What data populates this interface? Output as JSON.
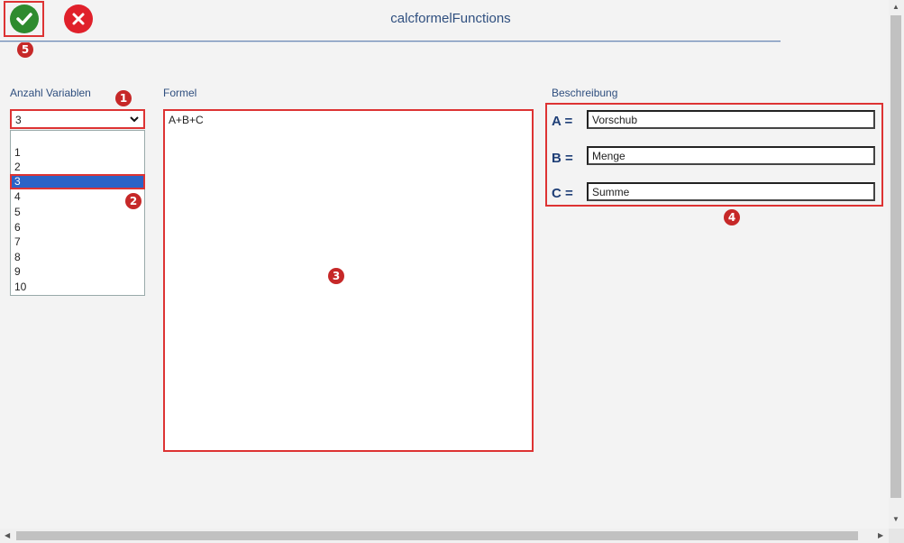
{
  "toolbar": {
    "ok_icon": "checkmark-circle-icon",
    "cancel_icon": "close-circle-icon",
    "ok_color": "#2e8b2e",
    "cancel_color": "#e0202a"
  },
  "title": "calcformelFunctions",
  "badges": [
    "1",
    "2",
    "3",
    "4",
    "5"
  ],
  "variables": {
    "label": "Anzahl Variablen",
    "selected": "3",
    "options": [
      "1",
      "2",
      "3",
      "4",
      "5",
      "6",
      "7",
      "8",
      "9",
      "10"
    ]
  },
  "formula": {
    "label": "Formel",
    "value": "A+B+C"
  },
  "description": {
    "label": "Beschreibung",
    "rows": [
      {
        "name": "A =",
        "value": "Vorschub"
      },
      {
        "name": "B =",
        "value": "Menge"
      },
      {
        "name": "C =",
        "value": "Summe"
      }
    ]
  },
  "colors": {
    "annotation_red": "#d33",
    "label_blue": "#2f4f7f",
    "selection_blue": "#2b63c7"
  }
}
